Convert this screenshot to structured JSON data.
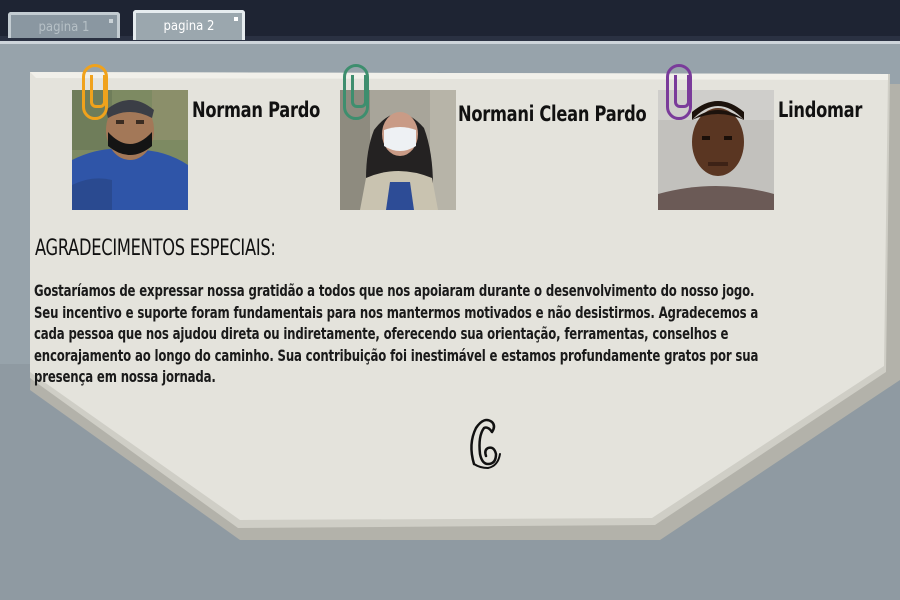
{
  "tabs": [
    {
      "label": "pagina 1",
      "active": false
    },
    {
      "label": "pagina 2",
      "active": true
    }
  ],
  "credits": [
    {
      "name": "Norman Pardo",
      "clip_color": "#f0a21c"
    },
    {
      "name": "Normani Clean Pardo",
      "clip_color": "#3e8e6e"
    },
    {
      "name": "Lindomar",
      "clip_color": "#7a3b9a"
    }
  ],
  "acknowledgements": {
    "title": "AGRADECIMENTOS ESPECIAIS:",
    "lines": [
      "Gostaríamos de expressar nossa gratidão a todos que nos apoiaram durante o desenvolvimento do nosso jogo.",
      "Seu incentivo e suporte foram fundamentais para nos mantermos motivados e não desistirmos. Agradecemos a",
      "cada pessoa que nos ajudou direta ou indiretamente, oferecendo sua orientação, ferramentas,  conselhos e",
      "encorajamento ao longo do caminho. Sua contribuição foi inestimável e estamos profundamente gratos por sua",
      "presença em nossa jornada."
    ]
  },
  "colors": {
    "panel": "#e4e3dc",
    "panel_shadow": "#c9c8c0",
    "background": "#8f9aa2",
    "top_bar": "#1e2433"
  }
}
